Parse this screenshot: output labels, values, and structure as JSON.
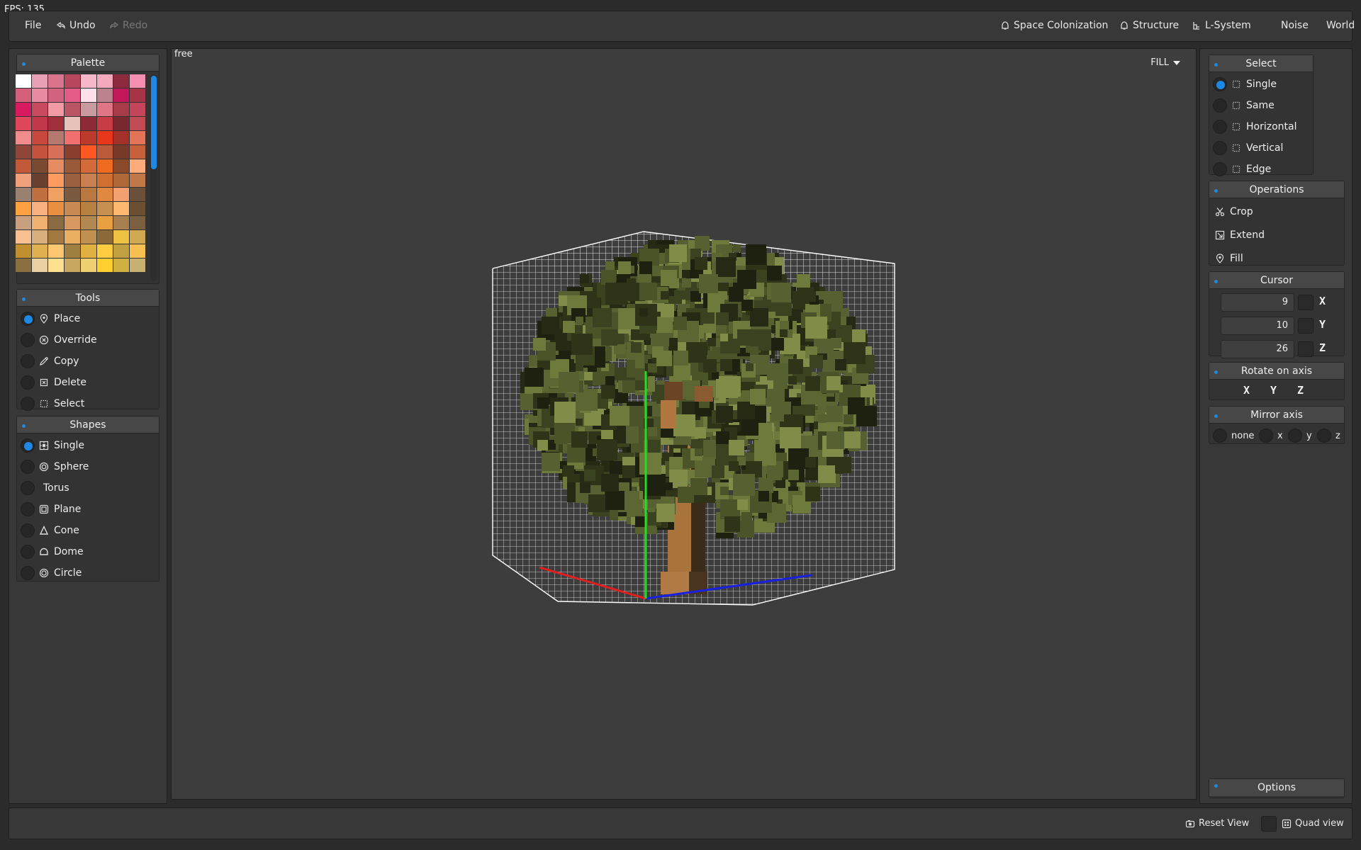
{
  "fps": "FPS: 135",
  "menu": {
    "file": "File",
    "undo": "Undo",
    "redo": "Redo",
    "space_colonization": "Space Colonization",
    "structure": "Structure",
    "l_system": "L-System",
    "noise": "Noise",
    "world": "World"
  },
  "palette": {
    "title": "Palette",
    "colors": [
      "#ffffff",
      "#e8a0b4",
      "#d9738e",
      "#b8475e",
      "#f6b7c9",
      "#f4a9bd",
      "#8d2a3d",
      "#f48fb1",
      "#d35f7a",
      "#e88aa2",
      "#d2627e",
      "#e45c85",
      "#ffe0ea",
      "#b9828c",
      "#c2185b",
      "#a83246",
      "#d81b60",
      "#c84a5e",
      "#f29aa3",
      "#ba5565",
      "#c99a9e",
      "#e07585",
      "#a83b48",
      "#c4455a",
      "#e0475d",
      "#c2384a",
      "#a02f3c",
      "#e8c1bb",
      "#8c2b35",
      "#c73c45",
      "#7a2830",
      "#c24a52",
      "#f28b8b",
      "#c8483d",
      "#b47a70",
      "#f07070",
      "#bb3a2c",
      "#e8371b",
      "#a33029",
      "#e37458",
      "#8f4638",
      "#c4523c",
      "#d86f58",
      "#8a3e30",
      "#ff5722",
      "#bb5a3a",
      "#7a3a2a",
      "#c8603a",
      "#c05a38",
      "#7a4a30",
      "#e58c62",
      "#9a5a3a",
      "#d26a3a",
      "#f06a20",
      "#8a4a2a",
      "#ffab7a",
      "#f0a07a",
      "#6a4030",
      "#ff9a60",
      "#9a6040",
      "#c88050",
      "#d07030",
      "#b06838",
      "#c07848",
      "#9a8070",
      "#c07040",
      "#f0a060",
      "#7a5a40",
      "#b87840",
      "#e08840",
      "#f2a070",
      "#6a5038",
      "#ffa040",
      "#f8b080",
      "#e89040",
      "#c88a50",
      "#b88040",
      "#c89050",
      "#ffb870",
      "#6a5030",
      "#c8a080",
      "#f0b070",
      "#8a6a40",
      "#d89860",
      "#b08850",
      "#e8a040",
      "#a88050",
      "#7a6040",
      "#f8c090",
      "#d8b080",
      "#a07840",
      "#e8b060",
      "#c09050",
      "#8a6a38",
      "#f0c040",
      "#d0a850",
      "#c09030",
      "#e0b050",
      "#ffc870",
      "#a08040",
      "#e0b040",
      "#ffcc40",
      "#c0a040",
      "#f8c050",
      "#8a7040",
      "#e8d0a0",
      "#ffe090",
      "#c8a860",
      "#f0d070",
      "#ffd030",
      "#d0b040",
      "#c8b070"
    ]
  },
  "tools": {
    "title": "Tools",
    "items": [
      "Place",
      "Override",
      "Copy",
      "Delete",
      "Select"
    ],
    "selected": "Place"
  },
  "shapes": {
    "title": "Shapes",
    "items": [
      "Single",
      "Sphere",
      "Torus",
      "Plane",
      "Cone",
      "Dome",
      "Circle"
    ],
    "selected": "Single"
  },
  "viewport": {
    "mode_label": "free",
    "fill_label": "FILL"
  },
  "select": {
    "title": "Select",
    "items": [
      "Single",
      "Same",
      "Horizontal",
      "Vertical",
      "Edge"
    ],
    "selected": "Single"
  },
  "operations": {
    "title": "Operations",
    "items": [
      "Crop",
      "Extend",
      "Fill"
    ]
  },
  "cursor": {
    "title": "Cursor",
    "x": "9",
    "y": "10",
    "z": "26",
    "x_label": "X",
    "y_label": "Y",
    "z_label": "Z"
  },
  "rotate": {
    "title": "Rotate on axis",
    "x": "X",
    "y": "Y",
    "z": "Z"
  },
  "mirror": {
    "title": "Mirror axis",
    "none": "none",
    "x": "x",
    "y": "y",
    "z": "z"
  },
  "options": {
    "title": "Options"
  },
  "bottom": {
    "reset_view": "Reset View",
    "quad_view": "Quad view"
  },
  "colors": {
    "accent": "#1e88e5",
    "axis_x": "#e02020",
    "axis_y": "#20e020",
    "axis_z": "#1a20e0"
  }
}
